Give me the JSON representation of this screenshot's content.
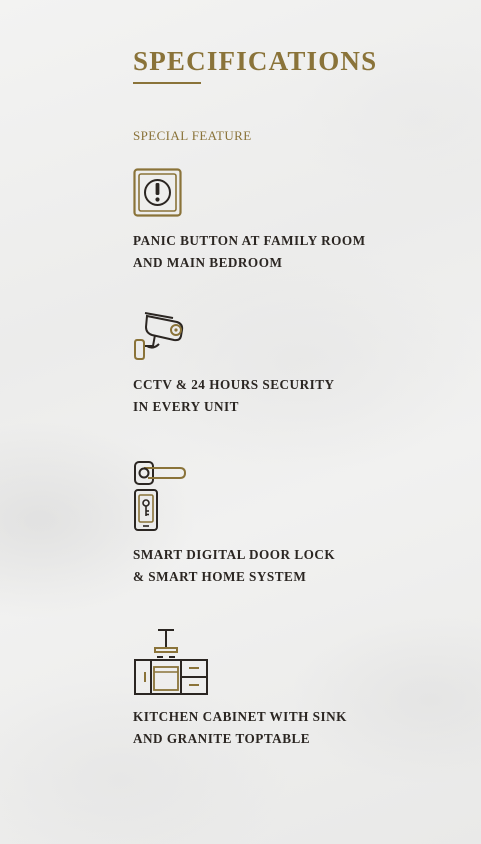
{
  "page": {
    "title": "SPECIFICATIONS",
    "subtitle": "SPECIAL FEATURE",
    "accent_color": "#8a7339",
    "text_color": "#2b2622"
  },
  "features": [
    {
      "icon": "panic-button-icon",
      "line1": "PANIC BUTTON AT FAMILY ROOM",
      "line2": "AND MAIN BEDROOM"
    },
    {
      "icon": "cctv-camera-icon",
      "line1": "CCTV & 24 HOURS SECURITY",
      "line2": "IN EVERY UNIT"
    },
    {
      "icon": "smart-door-lock-icon",
      "line1": "SMART DIGITAL DOOR LOCK",
      "line2": "& SMART HOME SYSTEM"
    },
    {
      "icon": "kitchen-cabinet-icon",
      "line1": "KITCHEN CABINET WITH SINK",
      "line2": "AND GRANITE TOPTABLE"
    }
  ]
}
